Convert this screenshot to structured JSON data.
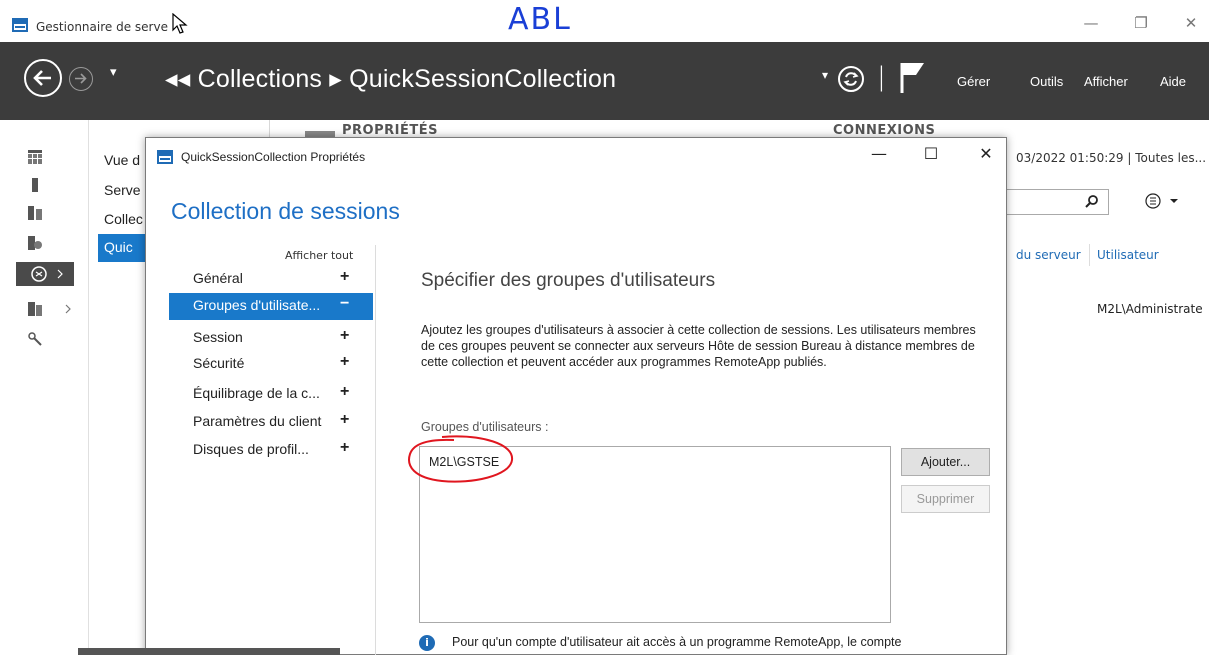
{
  "window": {
    "title": "Gestionnaire de serve",
    "minimize_icon": "minimize-icon",
    "restore_icon": "restore-icon",
    "close_icon": "close-icon"
  },
  "annotation": {
    "text": "ABL",
    "color": "#1a3fd6",
    "ellipse_color": "#e0161f"
  },
  "header": {
    "history_dropdown": "▾",
    "breadcrumb": "◂◂ Collections ▸ QuickSessionCollection",
    "breadcrumb_parts": [
      "Collections",
      "QuickSessionCollection"
    ],
    "refresh_dropdown": "▾",
    "separator": "|",
    "menu": [
      "Gérer",
      "Outils",
      "Afficher",
      "Aide"
    ]
  },
  "background": {
    "nav_items": [
      "Vue d",
      "Serve",
      "Collec",
      "Quic"
    ],
    "properties_heading": "PROPRIÉTÉS",
    "connections_heading": "CONNEXIONS",
    "timestamp": "03/2022 01:50:29 | Toutes les...",
    "column_headers": [
      "du serveur",
      "Utilisateur"
    ],
    "user_value": "M2L\\Administrate"
  },
  "dialog": {
    "title": "QuickSessionCollection Propriétés",
    "heading": "Collection de sessions",
    "show_all": "Afficher tout",
    "nav": [
      {
        "label": "Général",
        "toggle": "+",
        "selected": false
      },
      {
        "label": "Groupes d'utilisate...",
        "toggle": "−",
        "selected": true
      },
      {
        "label": "Session",
        "toggle": "+",
        "selected": false
      },
      {
        "label": "Sécurité",
        "toggle": "+",
        "selected": false
      },
      {
        "label": "Équilibrage de la c...",
        "toggle": "+",
        "selected": false
      },
      {
        "label": "Paramètres du client",
        "toggle": "+",
        "selected": false
      },
      {
        "label": "Disques de profil...",
        "toggle": "+",
        "selected": false
      }
    ],
    "content": {
      "title": "Spécifier des groupes d'utilisateurs",
      "description": "Ajoutez les groupes d'utilisateurs à associer à cette collection de sessions. Les utilisateurs membres de ces groupes peuvent se connecter aux serveurs Hôte de session Bureau à distance membres de cette collection et peuvent accéder aux programmes RemoteApp publiés.",
      "groups_label": "Groupes d'utilisateurs :",
      "groups": [
        "M2L\\GSTSE"
      ],
      "add_button": "Ajouter...",
      "remove_button": "Supprimer",
      "info_text": "Pour qu'un compte d'utilisateur ait accès à un programme RemoteApp, le compte"
    }
  },
  "colors": {
    "header_bg": "#3c3c3c",
    "accent": "#1979ca",
    "heading_blue": "#1e6fc5"
  }
}
